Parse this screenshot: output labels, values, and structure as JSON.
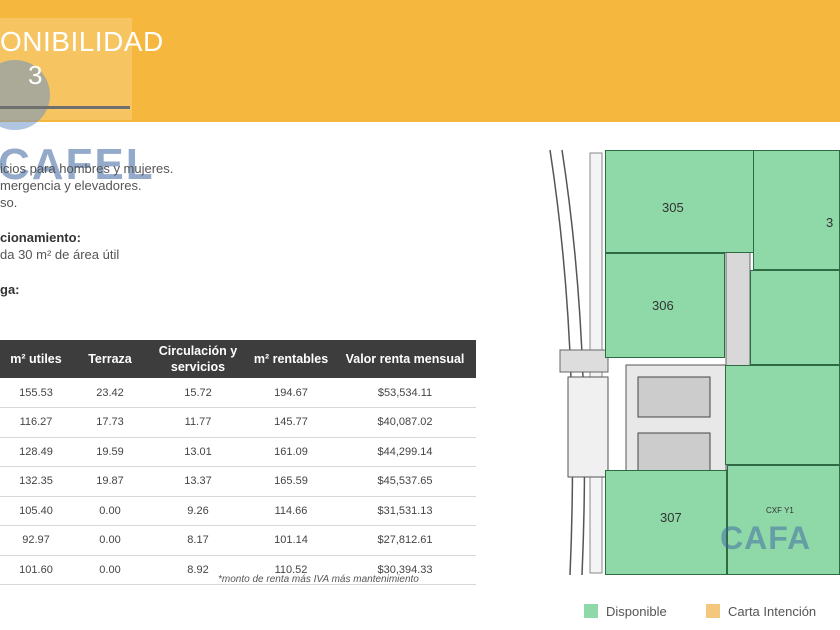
{
  "header": {
    "title": "ONIBILIDAD",
    "logo_text": "3"
  },
  "watermark": {
    "brand": "CAFEL",
    "brand_right": "CAFA"
  },
  "features": {
    "line1": "icios para hombres y mujeres.",
    "line2": "mergencia y elevadores.",
    "line3": "so.",
    "parking_title": "cionamiento:",
    "parking_text": "da 30 m² de área útil",
    "loading_title": "ga:"
  },
  "table": {
    "headers": [
      "m² utiles",
      "Terraza",
      "Circulación y servicios",
      "m² rentables",
      "Valor renta mensual"
    ],
    "rows": [
      [
        "155.53",
        "23.42",
        "15.72",
        "194.67",
        "$53,534.11"
      ],
      [
        "116.27",
        "17.73",
        "11.77",
        "145.77",
        "$40,087.02"
      ],
      [
        "128.49",
        "19.59",
        "13.01",
        "161.09",
        "$44,299.14"
      ],
      [
        "132.35",
        "19.87",
        "13.37",
        "165.59",
        "$45,537.65"
      ],
      [
        "105.40",
        "0.00",
        "9.26",
        "114.66",
        "$31,531.13"
      ],
      [
        "92.97",
        "0.00",
        "8.17",
        "101.14",
        "$27,812.61"
      ],
      [
        "101.60",
        "0.00",
        "8.92",
        "110.52",
        "$30,394.33"
      ]
    ],
    "note": "*monto de renta más IVA más mantenimiento"
  },
  "plan": {
    "units": [
      "305",
      "306",
      "307",
      "3"
    ],
    "cxf_label": "CXF Y1"
  },
  "legend": {
    "available_label": "Disponible",
    "available_color": "#8fd9a8",
    "letter_label": "Carta Intención",
    "letter_color": "#f5c77e"
  }
}
